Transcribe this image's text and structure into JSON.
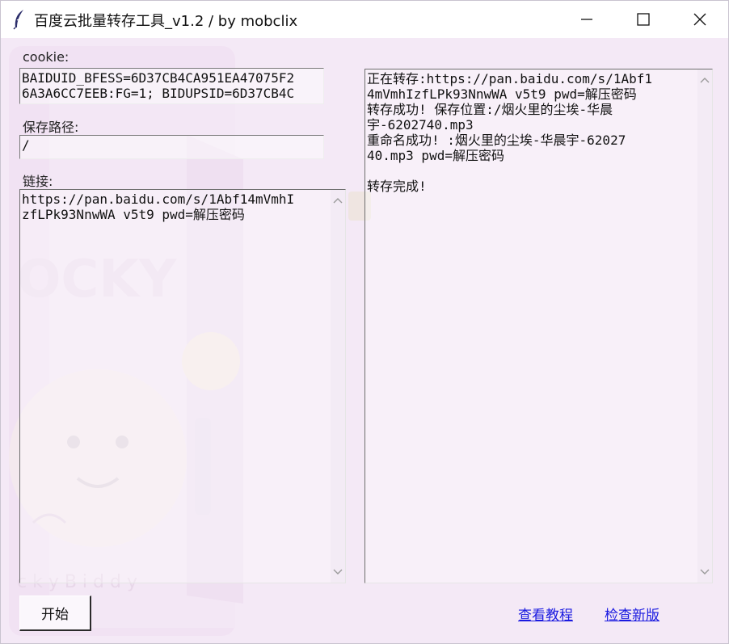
{
  "window": {
    "title": "百度云批量转存工具_v1.2 / by mobclix"
  },
  "icons": {
    "app": "feather-icon",
    "minimize": "minimize-icon",
    "maximize": "maximize-icon",
    "close": "close-icon",
    "scroll_up": "chevron-up-icon",
    "scroll_down": "chevron-down-icon"
  },
  "form": {
    "cookie_label": "cookie:",
    "cookie_lines": [
      "BAIDUID_BFESS=6D37CB4CA951EA47075F2",
      "6A3A6CC7EEB:FG=1; BIDUPSID=6D37CB4C"
    ],
    "path_label": "保存路径:",
    "path_value": "/",
    "links_label": "链接:",
    "links_lines": [
      "https://pan.baidu.com/s/1Abf14mVmhI",
      "zfLPk93NnwWA v5t9 pwd=解压密码"
    ]
  },
  "log": {
    "lines": [
      "正在转存:https://pan.baidu.com/s/1Abf1",
      "4mVmhIzfLPk93NnwWA v5t9 pwd=解压密码",
      "转存成功! 保存位置:/烟火里的尘埃-华晨",
      "宇-6202740.mp3",
      "重命名成功! :烟火里的尘埃-华晨宇-62027",
      "40.mp3 pwd=解压密码",
      "",
      "转存完成!"
    ]
  },
  "actions": {
    "start_label": "开始",
    "tutorial_label": "查看教程",
    "update_label": "检查新版"
  },
  "colors": {
    "window_bg": "#f4e9f6",
    "link": "#1a1ae0"
  }
}
